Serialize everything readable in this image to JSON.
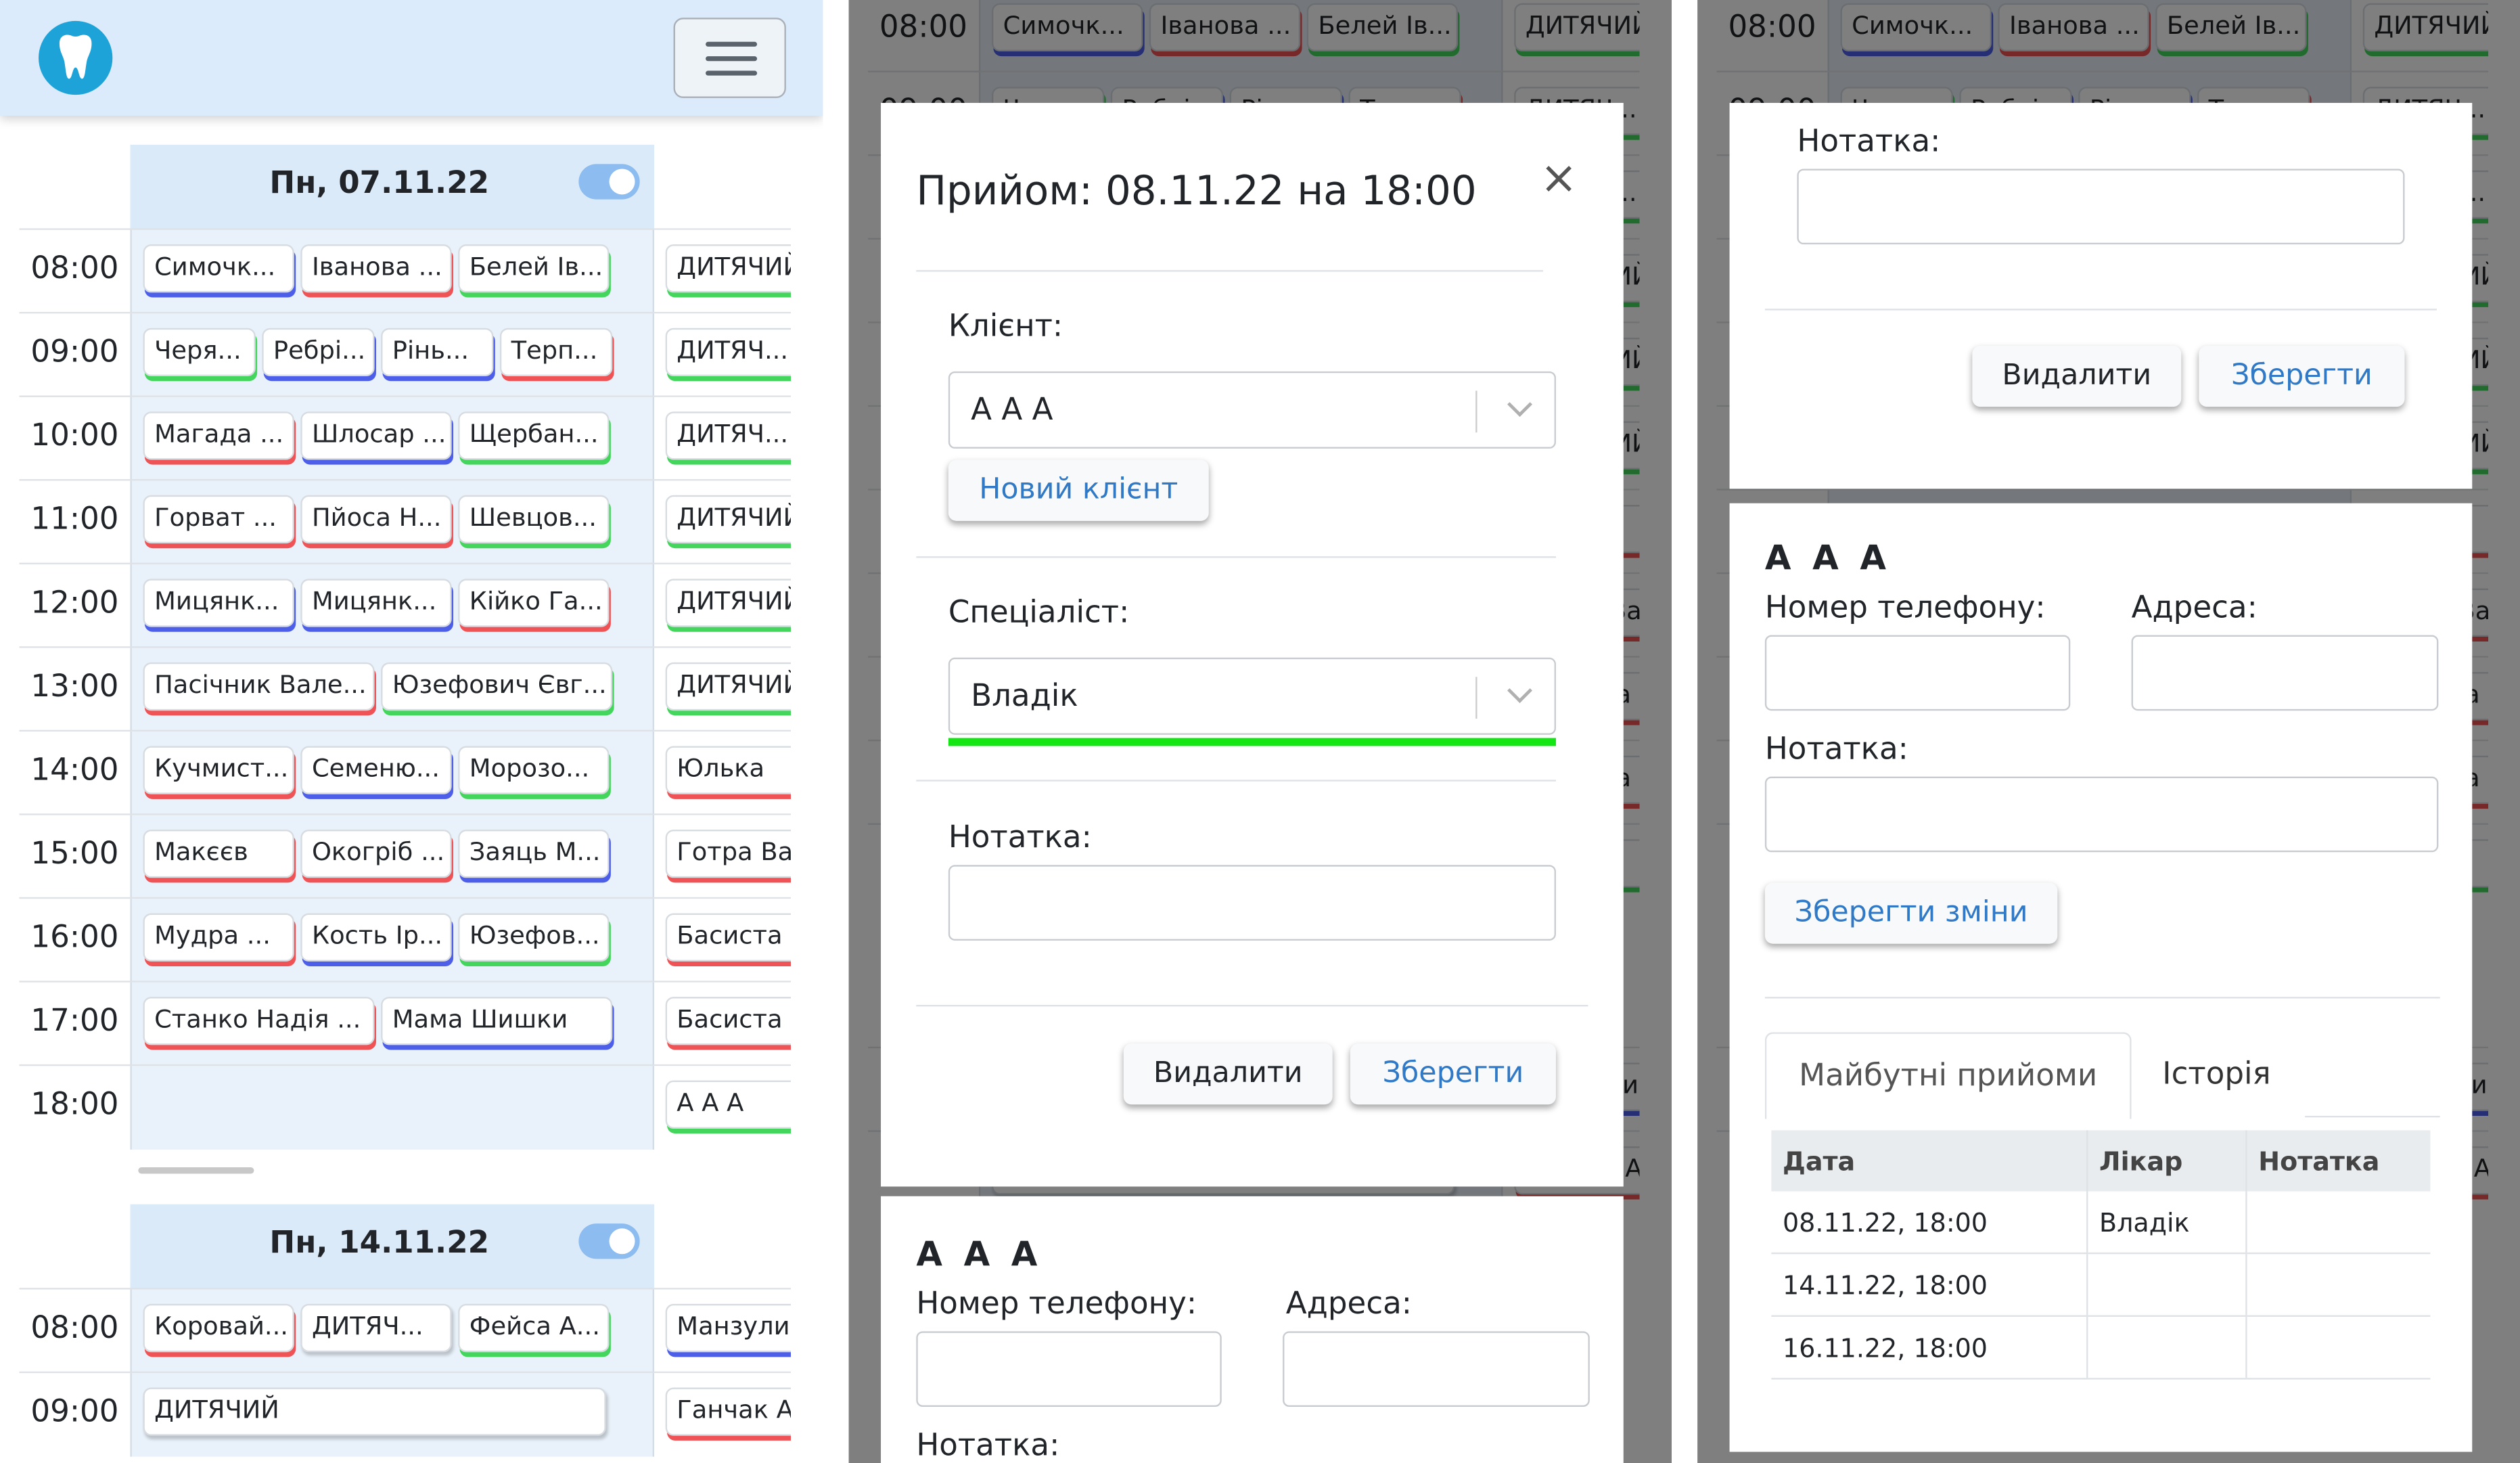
{
  "schedule": {
    "days": [
      {
        "label": "Пн, 07.11.22",
        "rows": [
          {
            "time": "08:00",
            "chips": [
              {
                "text": "Симочк...",
                "c": "b"
              },
              {
                "text": "Іванова ...",
                "c": "r"
              },
              {
                "text": "Белей Ів...",
                "c": "g"
              }
            ],
            "side": {
              "text": "ДИТЯЧИЙ",
              "c": "g"
            }
          },
          {
            "time": "09:00",
            "chips": [
              {
                "text": "Черя...",
                "c": "g"
              },
              {
                "text": "Ребрі...",
                "c": "b"
              },
              {
                "text": "Рінь...",
                "c": "b"
              },
              {
                "text": "Терп...",
                "c": "r"
              }
            ],
            "side": {
              "text": "ДИТЯЧ...",
              "c": "g"
            }
          },
          {
            "time": "10:00",
            "chips": [
              {
                "text": "Магада ...",
                "c": "r"
              },
              {
                "text": "Шлосар ...",
                "c": "b"
              },
              {
                "text": "Щербан...",
                "c": "g"
              }
            ],
            "side": {
              "text": "ДИТЯЧ...",
              "c": "g"
            }
          },
          {
            "time": "11:00",
            "chips": [
              {
                "text": "Горват ...",
                "c": "r"
              },
              {
                "text": "Пйоса Н...",
                "c": "r"
              },
              {
                "text": "Шевцов...",
                "c": "g"
              }
            ],
            "side": {
              "text": "ДИТЯЧИЙ",
              "c": "g"
            }
          },
          {
            "time": "12:00",
            "chips": [
              {
                "text": "Мицянк...",
                "c": "b"
              },
              {
                "text": "Мицянк...",
                "c": "b"
              },
              {
                "text": "Кійко Га...",
                "c": "r"
              }
            ],
            "side": {
              "text": "ДИТЯЧИЙ",
              "c": "g"
            }
          },
          {
            "time": "13:00",
            "chips": [
              {
                "text": "Пасічник Вале...",
                "c": "r"
              },
              {
                "text": "Юзефович Євг...",
                "c": "g"
              }
            ],
            "side": {
              "text": "ДИТЯЧИЙ",
              "c": "g"
            }
          },
          {
            "time": "14:00",
            "chips": [
              {
                "text": "Кучмист...",
                "c": "r"
              },
              {
                "text": "Семеню...",
                "c": "b"
              },
              {
                "text": "Морозо...",
                "c": "g"
              }
            ],
            "side": {
              "text": "Юлька",
              "c": "r"
            }
          },
          {
            "time": "15:00",
            "chips": [
              {
                "text": "Макєєв",
                "c": "r"
              },
              {
                "text": "Окогріб ...",
                "c": "r"
              },
              {
                "text": "Заяць М...",
                "c": "b"
              }
            ],
            "side": {
              "text": "Готра Вад",
              "c": "r"
            }
          },
          {
            "time": "16:00",
            "chips": [
              {
                "text": "Мудра ...",
                "c": "r"
              },
              {
                "text": "Кость Ір...",
                "c": "b"
              },
              {
                "text": "Юзефов...",
                "c": "g"
              }
            ],
            "side": {
              "text": "Басиста Є",
              "c": "r"
            }
          },
          {
            "time": "17:00",
            "chips": [
              {
                "text": "Станко Надія ...",
                "c": "r"
              },
              {
                "text": "Мама Шишки",
                "c": "b"
              }
            ],
            "side": {
              "text": "Басиста Є",
              "c": "r"
            }
          },
          {
            "time": "18:00",
            "chips": [],
            "side": {
              "text": "А А А",
              "c": "g"
            }
          }
        ]
      },
      {
        "label": "Пн, 14.11.22",
        "rows": [
          {
            "time": "08:00",
            "chips": [
              {
                "text": "Коровай...",
                "c": "r"
              },
              {
                "text": "ДИТЯЧ...",
                "c": "n"
              },
              {
                "text": "Фейса А...",
                "c": "g"
              }
            ],
            "side": {
              "text": "Манзулич",
              "c": "b"
            }
          },
          {
            "time": "09:00",
            "chips": [
              {
                "text": "ДИТЯЧИЙ",
                "c": "n"
              }
            ],
            "side": {
              "text": "Ганчак А.",
              "c": "r"
            }
          }
        ]
      }
    ]
  },
  "modal": {
    "title": "Прийом: 08.11.22 на 18:00",
    "close_glyph": "×",
    "client_label": "Клієнт:",
    "client_value": "А А А",
    "new_client_button": "Новий клієнт",
    "specialist_label": "Спеціаліст:",
    "specialist_value": "Владік",
    "note_label": "Нотатка:",
    "delete_button": "Видалити",
    "save_button": "Зберегти"
  },
  "client_card": {
    "name": "А А А",
    "phone_label": "Номер телефону:",
    "address_label": "Адреса:",
    "note_label": "Нотатка:",
    "save_changes_button": "Зберегти зміни",
    "tabs": [
      "Майбутні прийоми",
      "Історія"
    ],
    "table": {
      "headers": [
        "Дата",
        "Лікар",
        "Нотатка"
      ],
      "rows": [
        [
          "08.11.22, 18:00",
          "Владік",
          ""
        ],
        [
          "14.11.22, 18:00",
          "",
          ""
        ],
        [
          "16.11.22, 18:00",
          "",
          ""
        ]
      ]
    }
  },
  "colors": {
    "red": "#ef5355",
    "blue": "#4d5ee9",
    "green": "#44d65c",
    "header": "#dcebfb",
    "accent_green": "#14e614"
  }
}
